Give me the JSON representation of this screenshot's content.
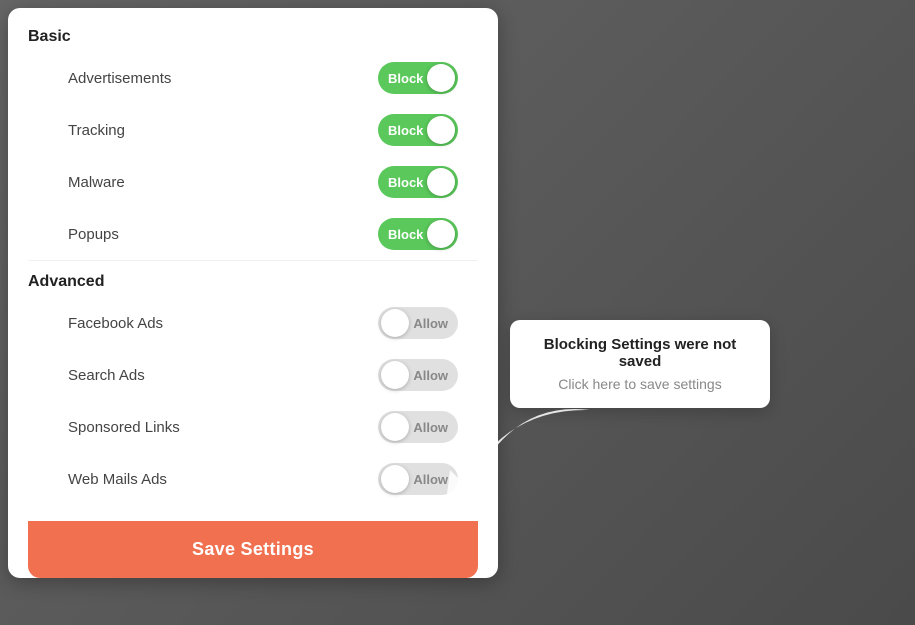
{
  "panel": {
    "sections": [
      {
        "title": "Basic",
        "items": [
          {
            "label": "Advertisements",
            "state": "block",
            "toggle_label": "Block"
          },
          {
            "label": "Tracking",
            "state": "block",
            "toggle_label": "Block"
          },
          {
            "label": "Malware",
            "state": "block",
            "toggle_label": "Block"
          },
          {
            "label": "Popups",
            "state": "block",
            "toggle_label": "Block"
          }
        ]
      },
      {
        "title": "Advanced",
        "items": [
          {
            "label": "Facebook Ads",
            "state": "allow",
            "toggle_label": "Allow"
          },
          {
            "label": "Search Ads",
            "state": "allow",
            "toggle_label": "Allow"
          },
          {
            "label": "Sponsored Links",
            "state": "allow",
            "toggle_label": "Allow"
          },
          {
            "label": "Web Mails Ads",
            "state": "allow",
            "toggle_label": "Allow"
          }
        ]
      }
    ],
    "save_button_label": "Save Settings"
  },
  "tooltip": {
    "title": "Blocking Settings were not saved",
    "subtitle": "Click here to save settings"
  }
}
